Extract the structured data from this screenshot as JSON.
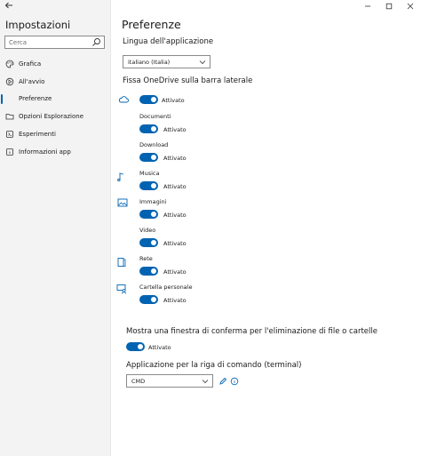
{
  "app": {
    "title": "Impostazioni"
  },
  "search": {
    "placeholder": "Cerca"
  },
  "sidebar": {
    "items": [
      {
        "label": "Grafica",
        "icon": "palette-icon"
      },
      {
        "label": "All'avvio",
        "icon": "startup-icon"
      },
      {
        "label": "Preferenze",
        "icon": "none",
        "active": true
      },
      {
        "label": "Opzioni Esplorazione",
        "icon": "folder-icon"
      },
      {
        "label": "Esperimenti",
        "icon": "flask-icon"
      },
      {
        "label": "Informazioni app",
        "icon": "info-icon"
      }
    ]
  },
  "main": {
    "page_title": "Preferenze",
    "language_label": "Lingua dell'applicazione",
    "language_value": "italiano (Italia)",
    "sidebar_pin_label": "Fissa OneDrive sulla barra laterale",
    "toggles": [
      {
        "name": "",
        "state": "Attivato",
        "icon": "cloud-icon"
      },
      {
        "name": "Documenti",
        "state": "Attivato",
        "icon": "none"
      },
      {
        "name": "Download",
        "state": "Attivato",
        "icon": "none"
      },
      {
        "name": "Musica",
        "state": "Attivato",
        "icon": "music-icon"
      },
      {
        "name": "Immagini",
        "state": "Attivato",
        "icon": "image-icon"
      },
      {
        "name": "Video",
        "state": "Attivato",
        "icon": "none"
      },
      {
        "name": "Rete",
        "state": "Attivato",
        "icon": "network-icon"
      },
      {
        "name": "Cartella personale",
        "state": "Attivato",
        "icon": "user-folder-icon"
      }
    ],
    "confirm_delete_label": "Mostra una finestra di conferma per l'eliminazione di file o cartelle",
    "confirm_delete_state": "Attivato",
    "terminal_label": "Applicazione per la riga di comando (terminal)",
    "terminal_value": "CMD"
  },
  "colors": {
    "accent": "#0063b1",
    "sidebar_bg": "#f3f3f3"
  }
}
